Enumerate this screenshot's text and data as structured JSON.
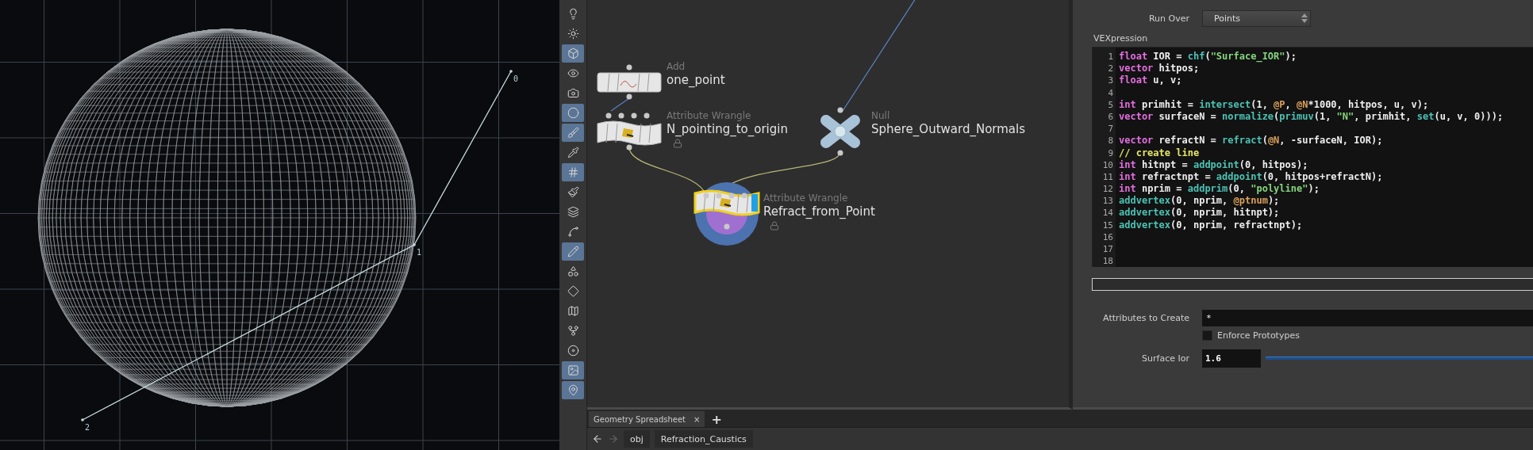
{
  "viewport": {
    "points": [
      {
        "label": "0"
      },
      {
        "label": "1"
      },
      {
        "label": "2"
      }
    ]
  },
  "toolbar": [
    {
      "selected": false
    },
    {
      "selected": false
    },
    {
      "selected": true
    },
    {
      "selected": false
    },
    {
      "selected": false
    },
    {
      "selected": true
    },
    {
      "selected": true
    },
    {
      "selected": false
    },
    {
      "selected": true
    },
    {
      "selected": false
    },
    {
      "selected": false
    },
    {
      "selected": false
    },
    {
      "selected": true
    },
    {
      "selected": false
    },
    {
      "selected": false
    },
    {
      "selected": false
    },
    {
      "selected": false
    },
    {
      "selected": false
    },
    {
      "selected": true
    },
    {
      "selected": true
    }
  ],
  "network": {
    "nodes": [
      {
        "kind": "add",
        "type": "Add",
        "name": "one_point",
        "locked": false,
        "selected": false
      },
      {
        "kind": "wrangle",
        "type": "Attribute Wrangle",
        "name": "N_pointing_to_origin",
        "locked": true,
        "selected": false
      },
      {
        "kind": "null",
        "type": "Null",
        "name": "Sphere_Outward_Normals",
        "locked": false,
        "selected": false
      },
      {
        "kind": "wrangle",
        "type": "Attribute Wrangle",
        "name": "Refract_from_Point",
        "locked": true,
        "selected": true
      }
    ]
  },
  "parameters": {
    "run_over": {
      "label": "Run Over",
      "value": "Points"
    },
    "vexpression": {
      "label": "VEXpression",
      "lines": [
        {
          "number": "1",
          "tokens": [
            {
              "kind": "kw",
              "text": "float"
            },
            {
              "kind": "plain",
              "text": " IOR = "
            },
            {
              "kind": "fn",
              "text": "chf"
            },
            {
              "kind": "plain",
              "text": "("
            },
            {
              "kind": "str",
              "text": "\"Surface_IOR\""
            },
            {
              "kind": "plain",
              "text": ");"
            }
          ]
        },
        {
          "number": "2",
          "tokens": [
            {
              "kind": "kw",
              "text": "vector"
            },
            {
              "kind": "plain",
              "text": " hitpos;"
            }
          ]
        },
        {
          "number": "3",
          "tokens": [
            {
              "kind": "kw",
              "text": "float"
            },
            {
              "kind": "plain",
              "text": " u, v;"
            }
          ]
        },
        {
          "number": "4"
        },
        {
          "number": "5",
          "tokens": [
            {
              "kind": "kw",
              "text": "int"
            },
            {
              "kind": "plain",
              "text": " primhit = "
            },
            {
              "kind": "fn",
              "text": "intersect"
            },
            {
              "kind": "plain",
              "text": "(1, "
            },
            {
              "kind": "attr",
              "text": "@P"
            },
            {
              "kind": "plain",
              "text": ", "
            },
            {
              "kind": "attr",
              "text": "@N"
            },
            {
              "kind": "plain",
              "text": "*1000, hitpos, u, v);"
            }
          ]
        },
        {
          "number": "6",
          "tokens": [
            {
              "kind": "kw",
              "text": "vector"
            },
            {
              "kind": "plain",
              "text": " surfaceN = "
            },
            {
              "kind": "fn",
              "text": "normalize"
            },
            {
              "kind": "plain",
              "text": "("
            },
            {
              "kind": "fn",
              "text": "primuv"
            },
            {
              "kind": "plain",
              "text": "(1, "
            },
            {
              "kind": "str",
              "text": "\"N\""
            },
            {
              "kind": "plain",
              "text": ", primhit, "
            },
            {
              "kind": "fn",
              "text": "set"
            },
            {
              "kind": "plain",
              "text": "(u, v, 0)));"
            }
          ]
        },
        {
          "number": "7"
        },
        {
          "number": "8",
          "tokens": [
            {
              "kind": "kw",
              "text": "vector"
            },
            {
              "kind": "plain",
              "text": " refractN = "
            },
            {
              "kind": "fn",
              "text": "refract"
            },
            {
              "kind": "plain",
              "text": "("
            },
            {
              "kind": "attr",
              "text": "@N"
            },
            {
              "kind": "plain",
              "text": ", -surfaceN, IOR);"
            }
          ]
        },
        {
          "number": "9",
          "tokens": [
            {
              "kind": "cm",
              "text": "// create line"
            }
          ]
        },
        {
          "number": "10",
          "tokens": [
            {
              "kind": "kw",
              "text": "int"
            },
            {
              "kind": "plain",
              "text": " hitnpt = "
            },
            {
              "kind": "fn",
              "text": "addpoint"
            },
            {
              "kind": "plain",
              "text": "(0, hitpos);"
            }
          ]
        },
        {
          "number": "11",
          "tokens": [
            {
              "kind": "kw",
              "text": "int"
            },
            {
              "kind": "plain",
              "text": " refractnpt = "
            },
            {
              "kind": "fn",
              "text": "addpoint"
            },
            {
              "kind": "plain",
              "text": "(0, hitpos+refractN);"
            }
          ]
        },
        {
          "number": "12",
          "tokens": [
            {
              "kind": "kw",
              "text": "int"
            },
            {
              "kind": "plain",
              "text": " nprim = "
            },
            {
              "kind": "fn",
              "text": "addprim"
            },
            {
              "kind": "plain",
              "text": "(0, "
            },
            {
              "kind": "str",
              "text": "\"polyline\""
            },
            {
              "kind": "plain",
              "text": ");"
            }
          ]
        },
        {
          "number": "13",
          "tokens": [
            {
              "kind": "fn",
              "text": "addvertex"
            },
            {
              "kind": "plain",
              "text": "(0, nprim, "
            },
            {
              "kind": "attr",
              "text": "@ptnum"
            },
            {
              "kind": "plain",
              "text": ");"
            }
          ]
        },
        {
          "number": "14",
          "tokens": [
            {
              "kind": "fn",
              "text": "addvertex"
            },
            {
              "kind": "plain",
              "text": "(0, nprim, hitnpt);"
            }
          ]
        },
        {
          "number": "15",
          "tokens": [
            {
              "kind": "fn",
              "text": "addvertex"
            },
            {
              "kind": "plain",
              "text": "(0, nprim, refractnpt);"
            }
          ]
        },
        {
          "number": "16"
        },
        {
          "number": "17"
        },
        {
          "number": "18"
        }
      ]
    },
    "attributes_to_create": {
      "label": "Attributes to Create",
      "value": "*"
    },
    "enforce_prototypes": {
      "label": "Enforce Prototypes",
      "checked": false
    },
    "surface_ior": {
      "label": "Surface Ior",
      "value": "1.6",
      "level": 1
    }
  },
  "bottom_pane": {
    "tabs": [
      {
        "label": "Geometry Spreadsheet",
        "selected": true,
        "close": "×"
      }
    ],
    "add_tab": "+",
    "path": [
      {
        "label": "obj"
      },
      {
        "label": "Refraction_Caustics"
      }
    ]
  }
}
